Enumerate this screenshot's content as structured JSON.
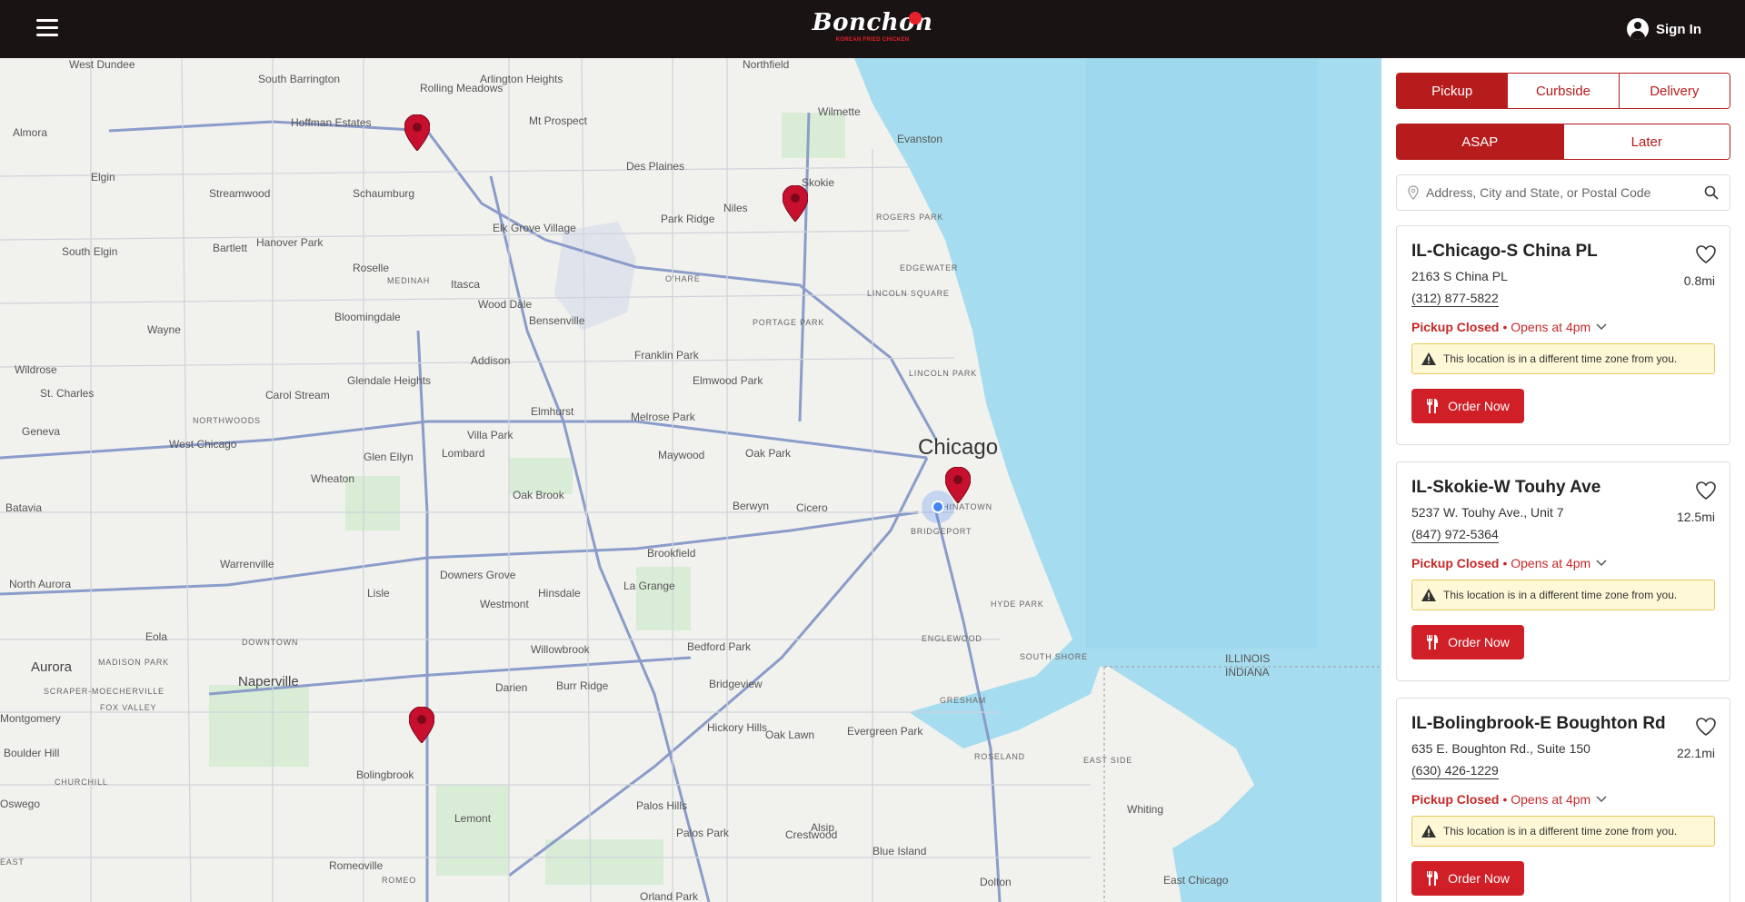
{
  "header": {
    "menu_icon": "hamburger-icon",
    "logo_text": "Bonchon",
    "logo_tagline": "KOREAN FRIED CHICKEN",
    "signin_label": "Sign In",
    "background_color": "#1a1314"
  },
  "map": {
    "place_labels": [
      {
        "text": "West Dundee"
      },
      {
        "text": "South Barrington"
      },
      {
        "text": "Rolling Meadows"
      },
      {
        "text": "Arlington Heights"
      },
      {
        "text": "Northfield"
      },
      {
        "text": "Hoffman Estates"
      },
      {
        "text": "Mt Prospect"
      },
      {
        "text": "Wilmette"
      },
      {
        "text": "Almora"
      },
      {
        "text": "Evanston"
      },
      {
        "text": "Des Plaines"
      },
      {
        "text": "Skokie"
      },
      {
        "text": "Schaumburg"
      },
      {
        "text": "Elgin"
      },
      {
        "text": "Streamwood"
      },
      {
        "text": "Niles"
      },
      {
        "text": "Park Ridge"
      },
      {
        "text": "Elk Grove Village"
      },
      {
        "text": "Bartlett"
      },
      {
        "text": "Hanover Park"
      },
      {
        "text": "South Elgin"
      },
      {
        "text": "Roselle"
      },
      {
        "text": "Itasca"
      },
      {
        "text": "Wood Dale"
      },
      {
        "text": "O'HARE"
      },
      {
        "text": "EDGEWATER"
      },
      {
        "text": "LINCOLN SQUARE"
      },
      {
        "text": "ROGERS PARK"
      },
      {
        "text": "MEDINAH"
      },
      {
        "text": "Bloomingdale"
      },
      {
        "text": "Bensenville"
      },
      {
        "text": "PORTAGE PARK"
      },
      {
        "text": "Wayne"
      },
      {
        "text": "Addison"
      },
      {
        "text": "Franklin Park"
      },
      {
        "text": "LINCOLN PARK"
      },
      {
        "text": "Wildrose"
      },
      {
        "text": "Glendale Heights"
      },
      {
        "text": "Elmwood Park"
      },
      {
        "text": "St. Charles"
      },
      {
        "text": "Carol Stream"
      },
      {
        "text": "NORTHWOODS"
      },
      {
        "text": "Elmhurst"
      },
      {
        "text": "Melrose Park"
      },
      {
        "text": "Geneva"
      },
      {
        "text": "Villa Park"
      },
      {
        "text": "Chicago"
      },
      {
        "text": "West Chicago"
      },
      {
        "text": "Lombard"
      },
      {
        "text": "Maywood"
      },
      {
        "text": "Oak Park"
      },
      {
        "text": "Glen Ellyn"
      },
      {
        "text": "Wheaton"
      },
      {
        "text": "Batavia"
      },
      {
        "text": "Oak Brook"
      },
      {
        "text": "Berwyn"
      },
      {
        "text": "Cicero"
      },
      {
        "text": "CHINATOWN"
      },
      {
        "text": "BRIDGEPORT"
      },
      {
        "text": "Warrenville"
      },
      {
        "text": "Brookfield"
      },
      {
        "text": "North Aurora"
      },
      {
        "text": "Downers Grove"
      },
      {
        "text": "Westmont"
      },
      {
        "text": "Hinsdale"
      },
      {
        "text": "La Grange"
      },
      {
        "text": "Lisle"
      },
      {
        "text": "HYDE PARK"
      },
      {
        "text": "Eola"
      },
      {
        "text": "DOWNTOWN"
      },
      {
        "text": "ENGLEWOOD"
      },
      {
        "text": "Aurora"
      },
      {
        "text": "Willowbrook"
      },
      {
        "text": "Bedford Park"
      },
      {
        "text": "SOUTH SHORE"
      },
      {
        "text": "ILLINOIS"
      },
      {
        "text": "INDIANA"
      },
      {
        "text": "MADISON PARK"
      },
      {
        "text": "SCRAPER-MOECHERVILLE"
      },
      {
        "text": "Naperville"
      },
      {
        "text": "Darien"
      },
      {
        "text": "Burr Ridge"
      },
      {
        "text": "Bridgeview"
      },
      {
        "text": "FOX VALLEY"
      },
      {
        "text": "Montgomery"
      },
      {
        "text": "Hickory Hills"
      },
      {
        "text": "Oak Lawn"
      },
      {
        "text": "Evergreen Park"
      },
      {
        "text": "GRESHAM"
      },
      {
        "text": "Boulder Hill"
      },
      {
        "text": "CHURCHILL"
      },
      {
        "text": "Bolingbrook"
      },
      {
        "text": "ROSELAND"
      },
      {
        "text": "EAST SIDE"
      },
      {
        "text": "Palos Hills"
      },
      {
        "text": "Oswego"
      },
      {
        "text": "Whiting"
      },
      {
        "text": "Lemont"
      },
      {
        "text": "Alsip"
      },
      {
        "text": "Palos Park"
      },
      {
        "text": "Crestwood"
      },
      {
        "text": "Blue Island"
      },
      {
        "text": "Romeoville"
      },
      {
        "text": "Dolton"
      },
      {
        "text": "East Chicago"
      },
      {
        "text": "ROMEO"
      },
      {
        "text": "Orland Park"
      },
      {
        "text": "EAST"
      }
    ],
    "pins": [
      "store-pin",
      "store-pin",
      "store-pin",
      "store-pin"
    ],
    "current_location": "you-are-here-dot",
    "pin_color": "#c8102e",
    "water_color": "#a6dcef"
  },
  "sidebar": {
    "fulfillment_tabs": [
      {
        "label": "Pickup",
        "active": true
      },
      {
        "label": "Curbside",
        "active": false
      },
      {
        "label": "Delivery",
        "active": false
      }
    ],
    "time_tabs": [
      {
        "label": "ASAP",
        "active": true
      },
      {
        "label": "Later",
        "active": false
      }
    ],
    "search": {
      "placeholder": "Address, City and State, or Postal Code",
      "value": ""
    },
    "accent_color": "#b71c1c",
    "locations": [
      {
        "name": "IL-Chicago-S China PL",
        "address": "2163 S China PL",
        "phone": "(312) 877-5822",
        "distance": "0.8mi",
        "status_closed": "Pickup Closed",
        "status_opens": "• Opens at 4pm",
        "warning": "This location is in a different time zone from you.",
        "order_label": "Order Now"
      },
      {
        "name": "IL-Skokie-W Touhy Ave",
        "address": "5237 W. Touhy Ave., Unit 7",
        "phone": "(847) 972-5364",
        "distance": "12.5mi",
        "status_closed": "Pickup Closed",
        "status_opens": "• Opens at 4pm",
        "warning": "This location is in a different time zone from you.",
        "order_label": "Order Now"
      },
      {
        "name": "IL-Bolingbrook-E Boughton Rd",
        "address": "635 E. Boughton Rd., Suite 150",
        "phone": "(630) 426-1229",
        "distance": "22.1mi",
        "status_closed": "Pickup Closed",
        "status_opens": "• Opens at 4pm",
        "warning": "This location is in a different time zone from you.",
        "order_label": "Order Now"
      }
    ]
  }
}
